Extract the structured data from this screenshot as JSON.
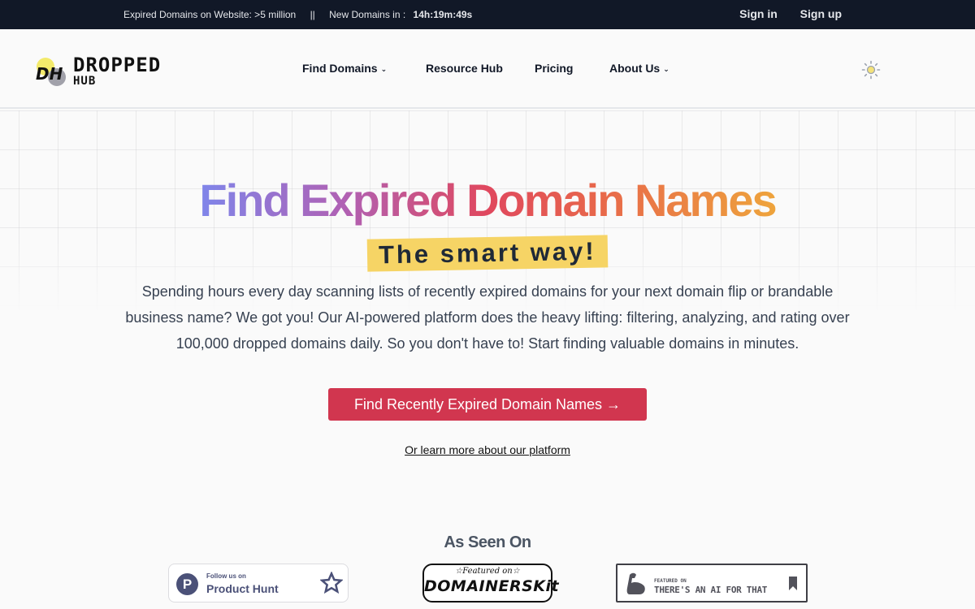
{
  "topbar": {
    "stats_label": "Expired Domains on Website: >5 million",
    "separator": "||",
    "countdown_label": "New Domains in :",
    "countdown_value": "14h:19m:49s",
    "sign_in": "Sign in",
    "sign_up": "Sign up"
  },
  "logo": {
    "monogram": "DH",
    "line1": "DROPPED",
    "line2": "HUB"
  },
  "nav": {
    "items": [
      {
        "label": "Find Domains",
        "dropdown": true
      },
      {
        "label": "Resource Hub",
        "dropdown": false
      },
      {
        "label": "Pricing",
        "dropdown": false
      },
      {
        "label": "About Us",
        "dropdown": true
      }
    ],
    "chevron_glyph": "⌄",
    "theme_icon": "sun-icon"
  },
  "hero": {
    "title": "Find Expired Domain Names",
    "gradient_colors": [
      "#7f86ea",
      "#b061b4",
      "#e0485e",
      "#e8694a",
      "#eea43c"
    ],
    "tagline": "The smart way!",
    "tagline_bg": "#f6d465",
    "description": "Spending hours every day scanning lists of recently expired domains for your next domain flip or brandable business name? We got you! Our AI-powered platform does the heavy lifting: filtering, analyzing, and rating over 100,000 dropped domains daily. So you don't have to! Start finding valuable domains in minutes.",
    "cta_label": "Find Recently Expired Domain Names →",
    "cta_color": "#d1364f",
    "learn_more": "Or learn more about our platform"
  },
  "as_seen_on": {
    "title": "As Seen On",
    "badges": [
      {
        "small": "Follow us on",
        "big": "Product Hunt",
        "monogram": "P"
      },
      {
        "small": "☆Featured on☆",
        "big": "DOMAINERSKit"
      },
      {
        "small": "FEATURED ON",
        "big": "THERE'S AN AI FOR THAT"
      }
    ]
  }
}
